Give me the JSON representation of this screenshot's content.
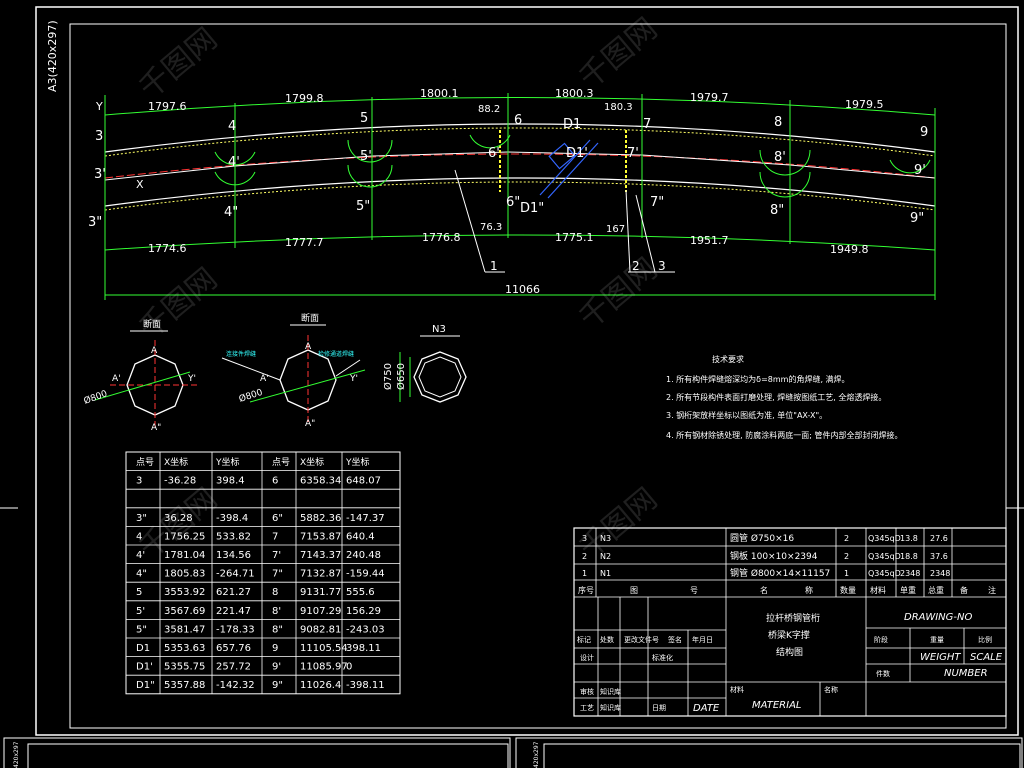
{
  "sheet": {
    "format_label": "A3(420x297)",
    "bottom_left_format": "420x297",
    "bottom_mid_format": "420x297"
  },
  "truss": {
    "top_dims": [
      "1797.6",
      "1799.8",
      "1800.1",
      "1800.3",
      "1979.7",
      "1979.5"
    ],
    "bottom_dims": [
      "1774.6",
      "1777.7",
      "1776.8",
      "1775.1",
      "1951.7",
      "1949.8"
    ],
    "total_dim": "11066",
    "small_dims": [
      "88.2",
      "180.3",
      "76.3",
      "167"
    ],
    "node_labels_top": [
      "3",
      "4",
      "5",
      "6",
      "D1",
      "7",
      "8",
      "9"
    ],
    "node_labels_mid": [
      "3'",
      "4'",
      "5'",
      "6'",
      "D1'",
      "7'",
      "8'",
      "9'"
    ],
    "node_labels_bot": [
      "3\"",
      "4\"",
      "5\"",
      "6\"",
      "D1\"",
      "7\"",
      "8\"",
      "9\""
    ],
    "axis_labels": [
      "Y",
      "X"
    ],
    "callouts": [
      "1",
      "2",
      "3"
    ]
  },
  "sections": {
    "left_title": "断面",
    "mid_title": "断面",
    "right_title": "N3",
    "left_dia": "Ø800",
    "mid_dia": "Ø800",
    "right_dims": [
      "Ø750",
      "Ø650"
    ],
    "left_marks": [
      "A",
      "A'",
      "Y",
      "Y'",
      "A\""
    ],
    "mid_marks": [
      "A",
      "A'",
      "Y'",
      "A\""
    ],
    "mid_notes": [
      "连接件焊缝",
      "检修通道焊缝"
    ]
  },
  "notes": {
    "title": "技术要求",
    "items": [
      "1. 所有构件焊缝熔深均为δ=8mm的角焊缝, 满焊。",
      "2. 所有节段构件表面打磨处理, 焊缝按图纸工艺, 全熔透焊接。",
      "3. 钢桁架放样坐标以图纸为准, 单位\"AX-X\"。",
      "4. 所有钢材除锈处理, 防腐涂料两底一面; 管件内部全部封闭焊接。"
    ]
  },
  "coord_table": {
    "headers": [
      "点号",
      "X坐标",
      "Y坐标",
      "点号",
      "X坐标",
      "Y坐标"
    ],
    "rows": [
      [
        "3",
        "-36.28",
        "398.4",
        "6",
        "6358.34",
        "648.07"
      ],
      [
        "",
        "",
        "",
        "",
        "",
        ""
      ],
      [
        "3\"",
        "36.28",
        "-398.4",
        "6\"",
        "5882.36",
        "-147.37"
      ],
      [
        "4",
        "1756.25",
        "533.82",
        "7",
        "7153.87",
        "640.4"
      ],
      [
        "4'",
        "1781.04",
        "134.56",
        "7'",
        "7143.37",
        "240.48"
      ],
      [
        "4\"",
        "1805.83",
        "-264.71",
        "7\"",
        "7132.87",
        "-159.44"
      ],
      [
        "5",
        "3553.92",
        "621.27",
        "8",
        "9131.77",
        "555.6"
      ],
      [
        "5'",
        "3567.69",
        "221.47",
        "8'",
        "9107.29",
        "156.29"
      ],
      [
        "5\"",
        "3581.47",
        "-178.33",
        "8\"",
        "9082.81",
        "-243.03"
      ],
      [
        "D1",
        "5353.63",
        "657.76",
        "9",
        "11105.54",
        "398.11"
      ],
      [
        "D1'",
        "5355.75",
        "257.72",
        "9'",
        "11085.97",
        "0"
      ],
      [
        "D1\"",
        "5357.88",
        "-142.32",
        "9\"",
        "11026.4",
        "-398.11"
      ]
    ]
  },
  "bom": {
    "rows": [
      [
        "3",
        "N3",
        "圆管 Ø750×16",
        "2",
        "Q345qD",
        "13.8",
        "27.6"
      ],
      [
        "2",
        "N2",
        "钢板 100×10×2394",
        "2",
        "Q345qD",
        "18.8",
        "37.6"
      ],
      [
        "1",
        "N1",
        "钢管 Ø800×14×11157",
        "1",
        "Q345qD",
        "2348",
        "2348"
      ]
    ],
    "headers": [
      "序号",
      "图",
      "号",
      "名",
      "称",
      "数量",
      "材料",
      "单重",
      "总重",
      "备",
      "注"
    ]
  },
  "title_block": {
    "drawing_title_lines": [
      "拉杆桥钢管桁",
      "桥梁K字撑",
      "结构图"
    ],
    "drawing_no": "DRAWING-NO",
    "labels": [
      "标记",
      "处数",
      "更改文件号",
      "签名",
      "年月日",
      "设计",
      "标准化",
      "审核",
      "工艺",
      "批准",
      "日期",
      "阶段",
      "重量",
      "比例",
      "件数",
      "材料",
      "名称"
    ],
    "weight": "WEIGHT",
    "scale": "SCALE",
    "number": "NUMBER",
    "date": "DATE",
    "material": "MATERIAL",
    "sign1": "知识库",
    "sign2": "知识库"
  },
  "watermark": "千图网"
}
